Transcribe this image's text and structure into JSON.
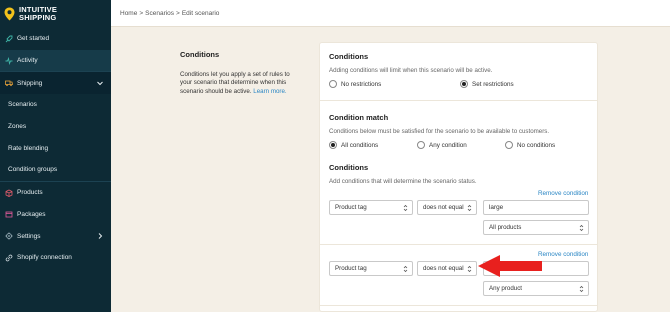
{
  "brand": {
    "line1": "INTUITIVE",
    "line2": "SHIPPING",
    "pin_color": "#f2c21b"
  },
  "sidebar": {
    "items": [
      {
        "label": "Get started",
        "icon": "rocket-icon"
      },
      {
        "label": "Activity",
        "icon": "activity-icon"
      },
      {
        "label": "Shipping",
        "icon": "truck-icon"
      },
      {
        "label": "Scenarios"
      },
      {
        "label": "Zones"
      },
      {
        "label": "Rate blending"
      },
      {
        "label": "Condition groups"
      },
      {
        "label": "Products",
        "icon": "box-icon"
      },
      {
        "label": "Packages",
        "icon": "package-icon"
      },
      {
        "label": "Settings",
        "icon": "gear-icon"
      },
      {
        "label": "Shopify connection",
        "icon": "link-icon"
      }
    ]
  },
  "breadcrumb": {
    "home": "Home",
    "scenarios": "Scenarios",
    "current": "Edit scenario",
    "sep": ">"
  },
  "description": {
    "title": "Conditions",
    "body": "Conditions let you apply a set of rules to your scenario that determine when this scenario should be active.",
    "link": "Learn more."
  },
  "card": {
    "conditions_header": {
      "title": "Conditions",
      "help": "Adding conditions will limit when this scenario will be active.",
      "opt_none": "No restrictions",
      "opt_set": "Set restrictions"
    },
    "match": {
      "title": "Condition match",
      "help": "Conditions below must be satisfied for the scenario to be available to customers.",
      "opt_all": "All conditions",
      "opt_any": "Any condition",
      "opt_no": "No conditions"
    },
    "list": {
      "title": "Conditions",
      "help": "Add conditions that will determine the scenario status.",
      "remove_label": "Remove condition",
      "rows": [
        {
          "field": "Product tag",
          "operator": "does not equal",
          "value": "large",
          "scope": "All products"
        },
        {
          "field": "Product tag",
          "operator": "does not equal",
          "value": "",
          "scope": "Any product"
        }
      ]
    }
  },
  "annotation": {
    "arrow_color": "#e8201e"
  }
}
